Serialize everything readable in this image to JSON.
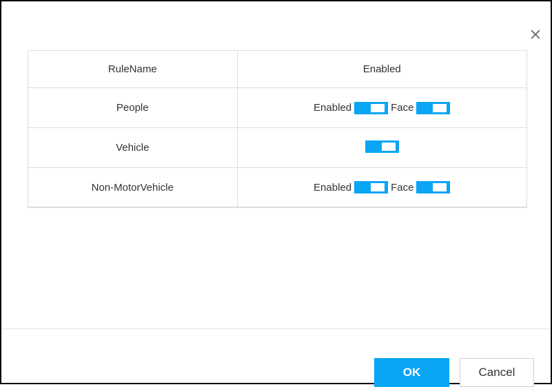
{
  "dialog": {
    "close_icon": "close-icon"
  },
  "table": {
    "headers": [
      "RuleName",
      "Enabled"
    ],
    "rows": [
      {
        "name": "People",
        "label1": "Enabled",
        "label2": "Face"
      },
      {
        "name": "Vehicle"
      },
      {
        "name": "Non-MotorVehicle",
        "label1": "Enabled",
        "label2": "Face"
      }
    ]
  },
  "toggles": {
    "people_enabled": true,
    "people_face": true,
    "vehicle_enabled": true,
    "nonmotor_enabled": true,
    "nonmotor_face": true
  },
  "footer": {
    "ok_label": "OK",
    "cancel_label": "Cancel"
  },
  "colors": {
    "accent": "#0aa5f5",
    "border": "#dcdcdc"
  }
}
